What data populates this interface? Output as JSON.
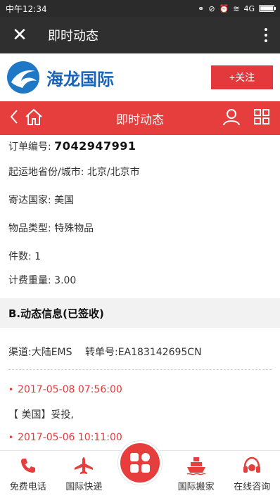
{
  "status_bar": {
    "time": "中午12:34",
    "network": "4G"
  },
  "nav": {
    "title": "即时动态"
  },
  "brand": {
    "name": "海龙国际",
    "follow_label": "+关注"
  },
  "redbar": {
    "title": "即时动态"
  },
  "order": {
    "number_label": "订单编号:",
    "number_value": "7042947991",
    "origin": "起运地省份/城市: 北京/北京市",
    "destination": "寄达国家: 美国",
    "item_type": "物品类型: 特殊物品",
    "pieces": "件数: 1",
    "weight": "计费重量: 3.00"
  },
  "section_b": {
    "title": "B.动态信息(已签收)"
  },
  "tracking": {
    "channel": "渠道:大陆EMS",
    "transfer_no": "转单号:EA183142695CN",
    "events": [
      {
        "time": "2017-05-08 07:56:00",
        "desc": "【 美国】妥投,"
      },
      {
        "time": "2017-05-06 10:11:00"
      }
    ]
  },
  "bottom_tabs": {
    "phone": "免费电话",
    "express": "国际快递",
    "moving": "国际搬家",
    "consult": "在线咨询"
  },
  "colors": {
    "accent": "#e63d3d",
    "brand_blue": "#1a64b8"
  }
}
